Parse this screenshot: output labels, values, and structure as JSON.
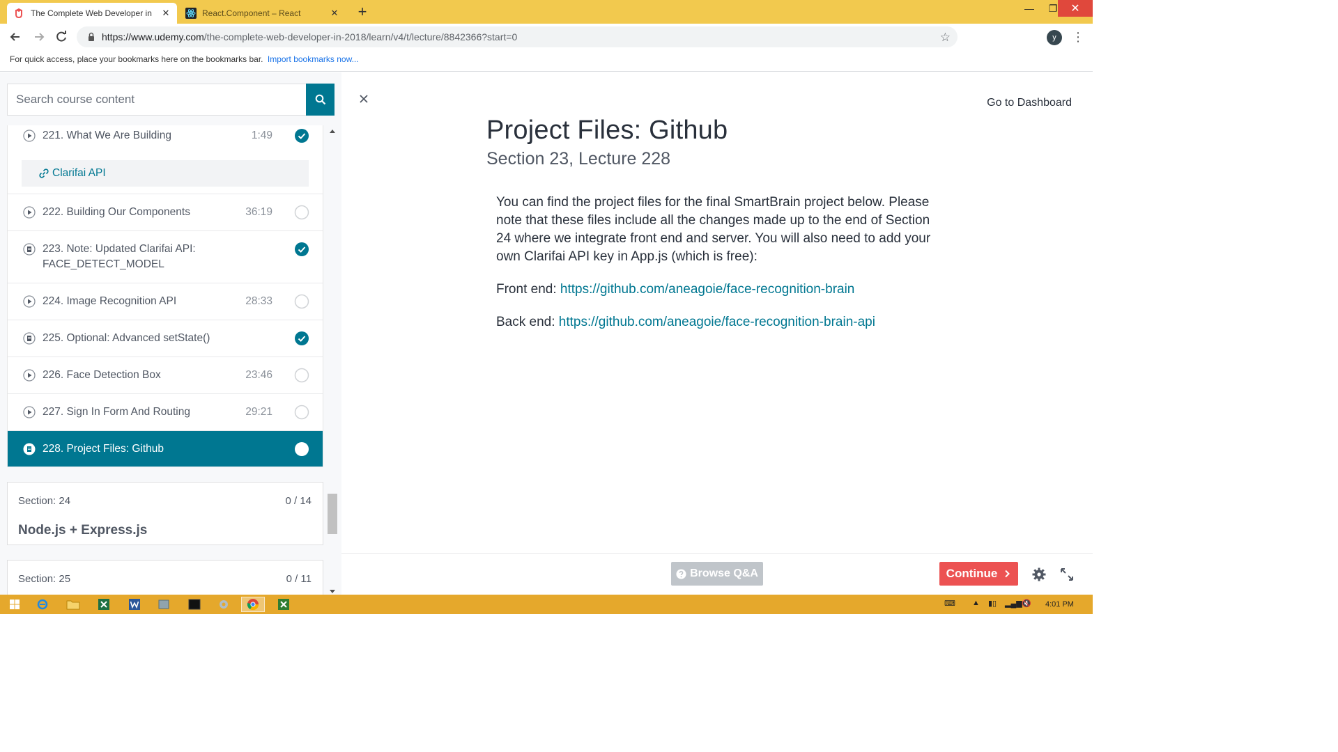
{
  "browser": {
    "tabs": [
      {
        "title": "The Complete Web Developer in",
        "icon": "udemy-icon"
      },
      {
        "title": "React.Component – React",
        "icon": "react-icon"
      }
    ],
    "new_tab_label": "+",
    "url_host": "https://www.udemy.com",
    "url_path": "/the-complete-web-developer-in-2018/learn/v4/t/lecture/8842366?start=0",
    "avatar_letter": "y",
    "bookmarks_text": "For quick access, place your bookmarks here on the bookmarks bar.",
    "bookmarks_link": "Import bookmarks now..."
  },
  "sidebar": {
    "search_placeholder": "Search course content",
    "resource_link": "Clarifai API",
    "items": [
      {
        "label": "221. What We Are Building",
        "duration": "1:49",
        "type": "video",
        "completed": true
      },
      {
        "label": "222. Building Our Components",
        "duration": "36:19",
        "type": "video",
        "completed": false
      },
      {
        "label": "223. Note: Updated Clarifai API:",
        "label2": "FACE_DETECT_MODEL",
        "duration": "",
        "type": "article",
        "completed": true
      },
      {
        "label": "224. Image Recognition API",
        "duration": "28:33",
        "type": "video",
        "completed": false
      },
      {
        "label": "225. Optional: Advanced setState()",
        "duration": "",
        "type": "article",
        "completed": true
      },
      {
        "label": "226. Face Detection Box",
        "duration": "23:46",
        "type": "video",
        "completed": false
      },
      {
        "label": "227. Sign In Form And Routing",
        "duration": "29:21",
        "type": "video",
        "completed": false
      },
      {
        "label": "228. Project Files: Github",
        "duration": "",
        "type": "article",
        "completed": false,
        "current": true
      }
    ],
    "sections": [
      {
        "name": "Section: 24",
        "count": "0 / 14",
        "title": "Node.js + Express.js"
      },
      {
        "name": "Section: 25",
        "count": "0 / 11",
        "title": ""
      }
    ]
  },
  "main": {
    "go_to_dashboard": "Go to Dashboard",
    "title": "Project Files: Github",
    "subtitle": "Section 23, Lecture 228",
    "paragraph": "You can find the project files for the final SmartBrain project below. Please note that these files include all the changes made up to the end of Section 24 where we integrate front end and server. You will also need to add your own Clarifai API key in App.js (which is free):",
    "front_label": "Front end:",
    "front_link": "https://github.com/aneagoie/face-recognition-brain",
    "back_label": "Back end:",
    "back_link": "https://github.com/aneagoie/face-recognition-brain-api"
  },
  "footer": {
    "browse_qa": "Browse Q&A",
    "continue": "Continue"
  },
  "taskbar": {
    "clock": "4:01 PM"
  },
  "colors": {
    "accent": "#007791",
    "continue": "#ec5252",
    "chrome_frame": "#f2c94e",
    "taskbar": "#e5a82c"
  }
}
